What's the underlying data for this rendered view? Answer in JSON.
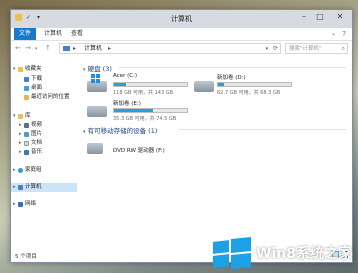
{
  "window": {
    "title": "计算机",
    "tabs": [
      "文件",
      "计算机",
      "查看"
    ]
  },
  "nav": {
    "back": "←",
    "forward": "→",
    "up": "↑",
    "recent": "▾",
    "address": "计算机",
    "address_sep": "▸",
    "refresh": "⟳",
    "search_placeholder": "搜索\"计算机\""
  },
  "sidebar": {
    "favorites": {
      "label": "收藏夹",
      "items": [
        "下载",
        "桌面",
        "最近访问的位置"
      ]
    },
    "libraries": {
      "label": "库",
      "items": [
        "视频",
        "图片",
        "文档",
        "音乐"
      ]
    },
    "homegroup": "家庭组",
    "computer": "计算机",
    "network": "网络"
  },
  "main": {
    "drives_header": "硬盘 (3)",
    "removable_header": "有可移动存储的设备 (1)",
    "drives": [
      {
        "name": "Acer (C:)",
        "free": "118 GB 可用，共 143 GB",
        "used_fraction": 0.17,
        "os": true
      },
      {
        "name": "新加卷 (D:)",
        "free": "62.7 GB 可用，共 68.3 GB",
        "used_fraction": 0.08
      },
      {
        "name": "新加卷 (E:)",
        "free": "35.3 GB 可用，共 74.5 GB",
        "used_fraction": 0.53
      }
    ],
    "removable": [
      {
        "name": "DVD RW 驱动器 (F:)"
      }
    ]
  },
  "status": {
    "count": "5 个项目"
  },
  "watermark": {
    "text": "Win8系统之家"
  },
  "colors": {
    "accent": "#1979ca",
    "bar_fill": "#26a0da",
    "header": "#1e3e8a"
  }
}
